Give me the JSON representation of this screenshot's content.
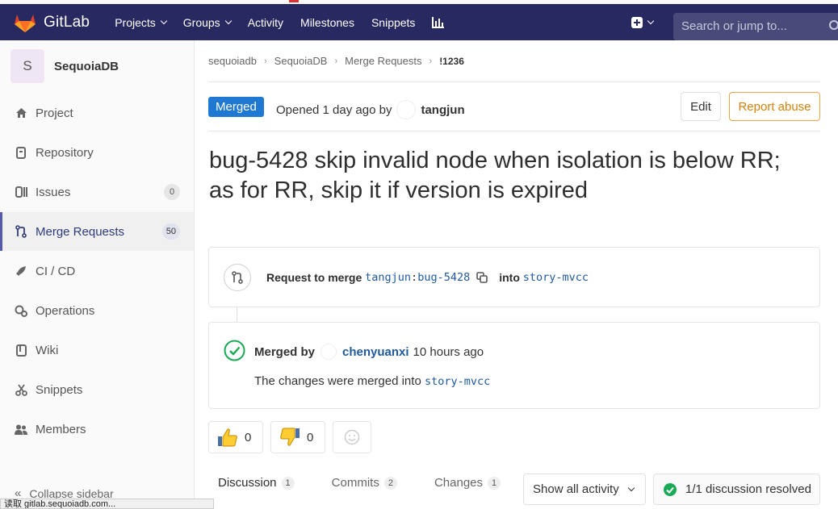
{
  "navbar": {
    "brand": "GitLab",
    "items": [
      {
        "label": "Projects",
        "dropdown": true
      },
      {
        "label": "Groups",
        "dropdown": true
      },
      {
        "label": "Activity",
        "dropdown": false
      },
      {
        "label": "Milestones",
        "dropdown": false
      },
      {
        "label": "Snippets",
        "dropdown": false
      }
    ],
    "search_placeholder": "Search or jump to..."
  },
  "sidebar": {
    "project_initial": "S",
    "project_name": "SequoiaDB",
    "items": [
      {
        "label": "Project",
        "icon": "home-icon",
        "count": null
      },
      {
        "label": "Repository",
        "icon": "doc-icon",
        "count": null
      },
      {
        "label": "Issues",
        "icon": "issues-icon",
        "count": "0"
      },
      {
        "label": "Merge Requests",
        "icon": "merge-request-icon",
        "count": "50",
        "active": true
      },
      {
        "label": "CI / CD",
        "icon": "rocket-icon",
        "count": null
      },
      {
        "label": "Operations",
        "icon": "cloud-gear-icon",
        "count": null
      },
      {
        "label": "Wiki",
        "icon": "book-icon",
        "count": null
      },
      {
        "label": "Snippets",
        "icon": "scissors-icon",
        "count": null
      },
      {
        "label": "Members",
        "icon": "users-icon",
        "count": null
      }
    ],
    "collapse_label": "Collapse sidebar"
  },
  "status_bar": "读取 gitlab.sequoiadb.com...",
  "breadcrumb": [
    "sequoiadb",
    "SequoiaDB",
    "Merge Requests",
    "!1236"
  ],
  "mr": {
    "state_badge": "Merged",
    "opened_text": "Opened 1 day ago by",
    "author": "tangjun",
    "edit_label": "Edit",
    "report_label": "Report abuse",
    "title": "bug-5428 skip invalid node when isolation is below RR; as for RR, skip it if version is expired",
    "request_prefix": "Request to merge",
    "source_user": "tangjun",
    "source_branch": "bug-5428",
    "into_label": "into",
    "target_branch": "story-mvcc",
    "merged_by_label": "Merged by",
    "merged_by_user": "chenyuanxi",
    "merged_time": "10 hours ago",
    "merged_into_text": "The changes were merged into",
    "merged_into_branch": "story-mvcc"
  },
  "awards": {
    "thumbs_up": "0",
    "thumbs_down": "0"
  },
  "tabs": [
    {
      "label": "Discussion",
      "count": "1",
      "active": true
    },
    {
      "label": "Commits",
      "count": "2"
    },
    {
      "label": "Changes",
      "count": "1"
    }
  ],
  "activity_filter": "Show all activity",
  "resolved_label": "1/1 discussion resolved",
  "colors": {
    "navbar": "#292961",
    "accent": "#1f78d1",
    "report": "#d4820b",
    "success": "#1aaa55"
  }
}
